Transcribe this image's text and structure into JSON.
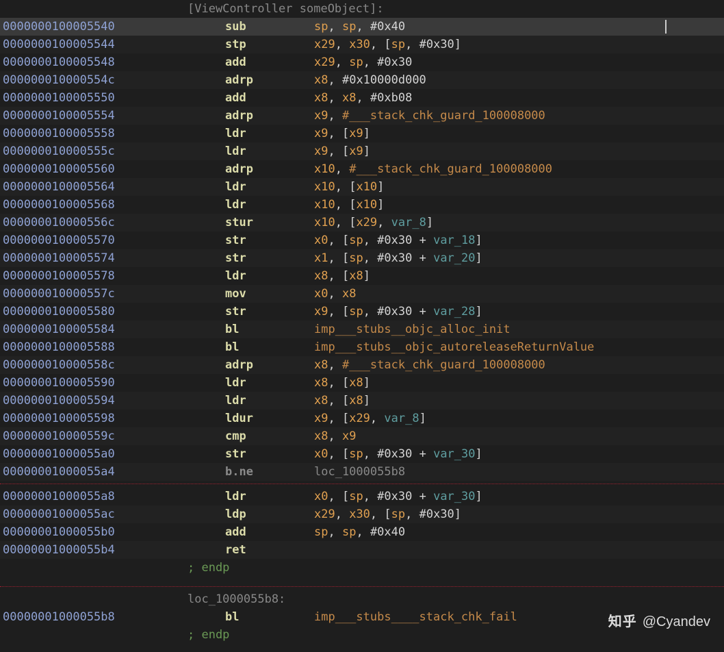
{
  "header": {
    "title": "[ViewController someObject]:"
  },
  "lines": [
    {
      "addr": "0000000100005540",
      "mn": "sub",
      "ops": [
        [
          "reg",
          "sp"
        ],
        [
          "p",
          ", "
        ],
        [
          "reg",
          "sp"
        ],
        [
          "p",
          ", "
        ],
        [
          "imm",
          "#0x40"
        ]
      ],
      "hl": true,
      "cursor": true
    },
    {
      "addr": "0000000100005544",
      "mn": "stp",
      "ops": [
        [
          "reg",
          "x29"
        ],
        [
          "p",
          ", "
        ],
        [
          "reg",
          "x30"
        ],
        [
          "p",
          ", ["
        ],
        [
          "reg",
          "sp"
        ],
        [
          "p",
          ", "
        ],
        [
          "imm",
          "#0x30"
        ],
        [
          "p",
          "]"
        ]
      ]
    },
    {
      "addr": "0000000100005548",
      "mn": "add",
      "ops": [
        [
          "reg",
          "x29"
        ],
        [
          "p",
          ", "
        ],
        [
          "reg",
          "sp"
        ],
        [
          "p",
          ", "
        ],
        [
          "imm",
          "#0x30"
        ]
      ]
    },
    {
      "addr": "000000010000554c",
      "mn": "adrp",
      "ops": [
        [
          "reg",
          "x8"
        ],
        [
          "p",
          ", "
        ],
        [
          "imm",
          "#0x10000d000"
        ]
      ]
    },
    {
      "addr": "0000000100005550",
      "mn": "add",
      "ops": [
        [
          "reg",
          "x8"
        ],
        [
          "p",
          ", "
        ],
        [
          "reg",
          "x8"
        ],
        [
          "p",
          ", "
        ],
        [
          "imm",
          "#0xb08"
        ]
      ]
    },
    {
      "addr": "0000000100005554",
      "mn": "adrp",
      "ops": [
        [
          "reg",
          "x9"
        ],
        [
          "p",
          ", "
        ],
        [
          "sym",
          "#___stack_chk_guard_100008000"
        ]
      ]
    },
    {
      "addr": "0000000100005558",
      "mn": "ldr",
      "ops": [
        [
          "reg",
          "x9"
        ],
        [
          "p",
          ", ["
        ],
        [
          "reg",
          "x9"
        ],
        [
          "p",
          "]"
        ]
      ]
    },
    {
      "addr": "000000010000555c",
      "mn": "ldr",
      "ops": [
        [
          "reg",
          "x9"
        ],
        [
          "p",
          ", ["
        ],
        [
          "reg",
          "x9"
        ],
        [
          "p",
          "]"
        ]
      ]
    },
    {
      "addr": "0000000100005560",
      "mn": "adrp",
      "ops": [
        [
          "reg",
          "x10"
        ],
        [
          "p",
          ", "
        ],
        [
          "sym",
          "#___stack_chk_guard_100008000"
        ]
      ]
    },
    {
      "addr": "0000000100005564",
      "mn": "ldr",
      "ops": [
        [
          "reg",
          "x10"
        ],
        [
          "p",
          ", ["
        ],
        [
          "reg",
          "x10"
        ],
        [
          "p",
          "]"
        ]
      ]
    },
    {
      "addr": "0000000100005568",
      "mn": "ldr",
      "ops": [
        [
          "reg",
          "x10"
        ],
        [
          "p",
          ", ["
        ],
        [
          "reg",
          "x10"
        ],
        [
          "p",
          "]"
        ]
      ]
    },
    {
      "addr": "000000010000556c",
      "mn": "stur",
      "ops": [
        [
          "reg",
          "x10"
        ],
        [
          "p",
          ", ["
        ],
        [
          "reg",
          "x29"
        ],
        [
          "p",
          ", "
        ],
        [
          "var",
          "var_8"
        ],
        [
          "p",
          "]"
        ]
      ]
    },
    {
      "addr": "0000000100005570",
      "mn": "str",
      "ops": [
        [
          "reg",
          "x0"
        ],
        [
          "p",
          ", ["
        ],
        [
          "reg",
          "sp"
        ],
        [
          "p",
          ", "
        ],
        [
          "imm",
          "#0x30"
        ],
        [
          "p",
          " + "
        ],
        [
          "var",
          "var_18"
        ],
        [
          "p",
          "]"
        ]
      ]
    },
    {
      "addr": "0000000100005574",
      "mn": "str",
      "ops": [
        [
          "reg",
          "x1"
        ],
        [
          "p",
          ", ["
        ],
        [
          "reg",
          "sp"
        ],
        [
          "p",
          ", "
        ],
        [
          "imm",
          "#0x30"
        ],
        [
          "p",
          " + "
        ],
        [
          "var",
          "var_20"
        ],
        [
          "p",
          "]"
        ]
      ]
    },
    {
      "addr": "0000000100005578",
      "mn": "ldr",
      "ops": [
        [
          "reg",
          "x8"
        ],
        [
          "p",
          ", ["
        ],
        [
          "reg",
          "x8"
        ],
        [
          "p",
          "]"
        ]
      ]
    },
    {
      "addr": "000000010000557c",
      "mn": "mov",
      "ops": [
        [
          "reg",
          "x0"
        ],
        [
          "p",
          ", "
        ],
        [
          "reg",
          "x8"
        ]
      ]
    },
    {
      "addr": "0000000100005580",
      "mn": "str",
      "ops": [
        [
          "reg",
          "x9"
        ],
        [
          "p",
          ", ["
        ],
        [
          "reg",
          "sp"
        ],
        [
          "p",
          ", "
        ],
        [
          "imm",
          "#0x30"
        ],
        [
          "p",
          " + "
        ],
        [
          "var",
          "var_28"
        ],
        [
          "p",
          "]"
        ]
      ]
    },
    {
      "addr": "0000000100005584",
      "mn": "bl",
      "ops": [
        [
          "sym",
          "imp___stubs__objc_alloc_init"
        ]
      ]
    },
    {
      "addr": "0000000100005588",
      "mn": "bl",
      "ops": [
        [
          "sym",
          "imp___stubs__objc_autoreleaseReturnValue"
        ]
      ]
    },
    {
      "addr": "000000010000558c",
      "mn": "adrp",
      "ops": [
        [
          "reg",
          "x8"
        ],
        [
          "p",
          ", "
        ],
        [
          "sym",
          "#___stack_chk_guard_100008000"
        ]
      ]
    },
    {
      "addr": "0000000100005590",
      "mn": "ldr",
      "ops": [
        [
          "reg",
          "x8"
        ],
        [
          "p",
          ", ["
        ],
        [
          "reg",
          "x8"
        ],
        [
          "p",
          "]"
        ]
      ]
    },
    {
      "addr": "0000000100005594",
      "mn": "ldr",
      "ops": [
        [
          "reg",
          "x8"
        ],
        [
          "p",
          ", ["
        ],
        [
          "reg",
          "x8"
        ],
        [
          "p",
          "]"
        ]
      ]
    },
    {
      "addr": "0000000100005598",
      "mn": "ldur",
      "ops": [
        [
          "reg",
          "x9"
        ],
        [
          "p",
          ", ["
        ],
        [
          "reg",
          "x29"
        ],
        [
          "p",
          ", "
        ],
        [
          "var",
          "var_8"
        ],
        [
          "p",
          "]"
        ]
      ]
    },
    {
      "addr": "000000010000559c",
      "mn": "cmp",
      "ops": [
        [
          "reg",
          "x8"
        ],
        [
          "p",
          ", "
        ],
        [
          "reg",
          "x9"
        ]
      ]
    },
    {
      "addr": "00000001000055a0",
      "mn": "str",
      "ops": [
        [
          "reg",
          "x0"
        ],
        [
          "p",
          ", ["
        ],
        [
          "reg",
          "sp"
        ],
        [
          "p",
          ", "
        ],
        [
          "imm",
          "#0x30"
        ],
        [
          "p",
          " + "
        ],
        [
          "var",
          "var_30"
        ],
        [
          "p",
          "]"
        ]
      ]
    },
    {
      "addr": "00000001000055a4",
      "mn": "b.ne",
      "dim": true,
      "ops": [
        [
          "label",
          "loc_1000055b8"
        ]
      ]
    }
  ],
  "block2": [
    {
      "addr": "00000001000055a8",
      "mn": "ldr",
      "ops": [
        [
          "reg",
          "x0"
        ],
        [
          "p",
          ", ["
        ],
        [
          "reg",
          "sp"
        ],
        [
          "p",
          ", "
        ],
        [
          "imm",
          "#0x30"
        ],
        [
          "p",
          " + "
        ],
        [
          "var",
          "var_30"
        ],
        [
          "p",
          "]"
        ]
      ]
    },
    {
      "addr": "00000001000055ac",
      "mn": "ldp",
      "ops": [
        [
          "reg",
          "x29"
        ],
        [
          "p",
          ", "
        ],
        [
          "reg",
          "x30"
        ],
        [
          "p",
          ", ["
        ],
        [
          "reg",
          "sp"
        ],
        [
          "p",
          ", "
        ],
        [
          "imm",
          "#0x30"
        ],
        [
          "p",
          "]"
        ]
      ]
    },
    {
      "addr": "00000001000055b0",
      "mn": "add",
      "ops": [
        [
          "reg",
          "sp"
        ],
        [
          "p",
          ", "
        ],
        [
          "reg",
          "sp"
        ],
        [
          "p",
          ", "
        ],
        [
          "imm",
          "#0x40"
        ]
      ]
    },
    {
      "addr": "00000001000055b4",
      "mn": "ret",
      "ops": []
    }
  ],
  "endp": "; endp",
  "loc_label": "loc_1000055b8:",
  "block3": [
    {
      "addr": "00000001000055b8",
      "mn": "bl",
      "ops": [
        [
          "sym",
          "imp___stubs____stack_chk_fail"
        ]
      ]
    }
  ],
  "watermark": {
    "brand": "知乎",
    "user": "@Cyandev"
  }
}
